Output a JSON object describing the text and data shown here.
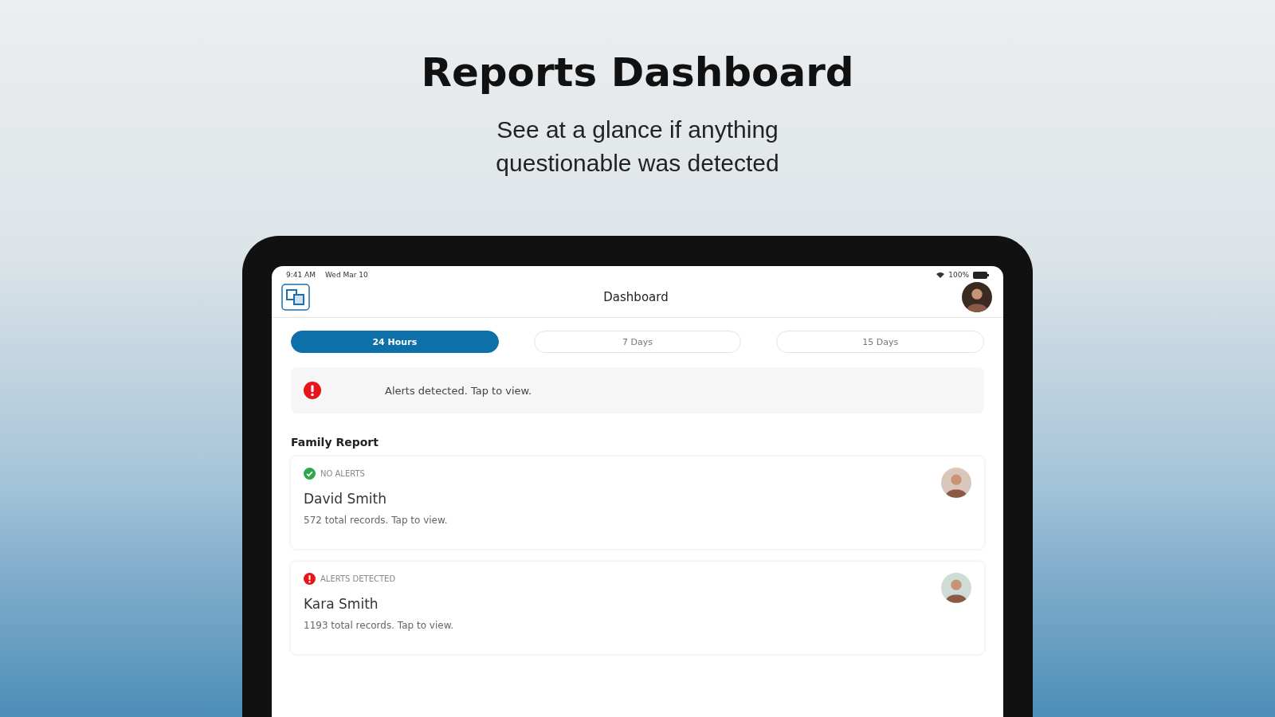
{
  "headline": "Reports Dashboard",
  "subtitle": [
    "See at a glance if anything",
    "questionable was detected"
  ],
  "status_bar": {
    "time": "9:41 AM",
    "date": "Wed Mar 10",
    "battery": "100%"
  },
  "header": {
    "title": "Dashboard"
  },
  "tabs": [
    {
      "label": "24 Hours",
      "selected": true
    },
    {
      "label": "7 Days",
      "selected": false
    },
    {
      "label": "15 Days",
      "selected": false
    }
  ],
  "banner": {
    "kind": "alert",
    "text": "Alerts detected. Tap to view."
  },
  "section_title": "Family Report",
  "reports": [
    {
      "kind": "ok",
      "status": "NO ALERTS",
      "name": "David Smith",
      "summary": "572 total records. Tap to view."
    },
    {
      "kind": "alert",
      "status": "ALERTS DETECTED",
      "name": "Kara Smith",
      "summary": "1193 total records. Tap to view."
    }
  ]
}
